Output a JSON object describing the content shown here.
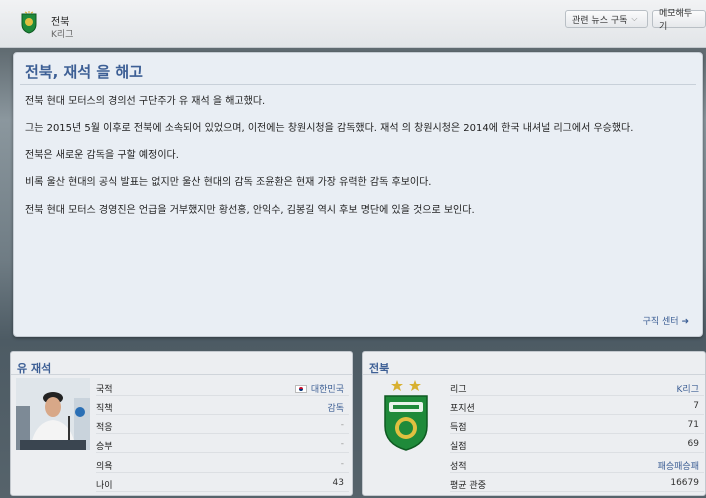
{
  "header": {
    "club_name": "전북",
    "league": "K리그",
    "news_button": "관련 뉴스 구독",
    "memo_button": "메모해두기"
  },
  "news": {
    "title": "전북, 재석 을 해고",
    "paragraphs": [
      "전북 현대 모터스의 경의선 구단주가 유 재석 을 해고했다.",
      "그는 2015년 5월 이후로 전북에 소속되어 있었으며, 이전에는 창원시청을 감독했다. 재석 의 창원시청은 2014에 한국 내셔널 리그에서 우승했다.",
      "전북은 새로운 감독을 구할 예정이다.",
      "비록 울산 현대의 공식 발표는 없지만 울산 현대의 감독 조윤환은 현재 가장 유력한 감독 후보이다.",
      "전북 현대 모터스 경영진은 언급을 거부했지만 황선홍, 안익수, 김봉길 역시 후보 명단에 있을 것으로 보인다."
    ],
    "link": "구직 센터"
  },
  "person_panel": {
    "title": "유 재석",
    "rows": [
      {
        "label": "국적",
        "value": "대한민국"
      },
      {
        "label": "직책",
        "value": "감독"
      },
      {
        "label": "적응",
        "value": "-"
      },
      {
        "label": "승부",
        "value": "-"
      },
      {
        "label": "의욕",
        "value": "-"
      },
      {
        "label": "나이",
        "value": "43"
      }
    ]
  },
  "club_panel": {
    "title": "전북",
    "rows": [
      {
        "label": "리그",
        "value": "K리그"
      },
      {
        "label": "포지션",
        "value": "7"
      },
      {
        "label": "득점",
        "value": "71"
      },
      {
        "label": "실점",
        "value": "69"
      },
      {
        "label": "성적",
        "value": "패승패승패"
      },
      {
        "label": "평균 관중",
        "value": "16679"
      }
    ]
  },
  "colors": {
    "accent": "#3d5f95",
    "crest_green": "#1f8a3a",
    "crest_gold": "#e0c040"
  }
}
